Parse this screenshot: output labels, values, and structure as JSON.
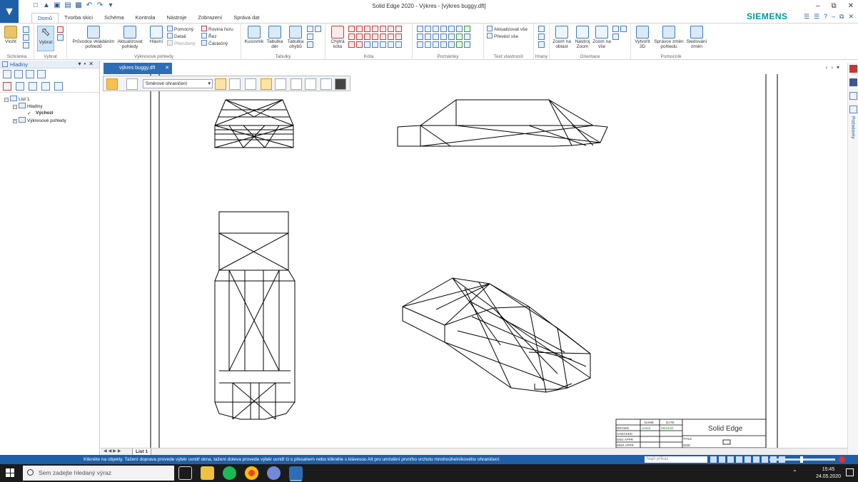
{
  "window": {
    "title": "Solid Edge 2020 - Výkres - [výkres buggy.dft]",
    "brand": "SIEMENS"
  },
  "ribbon_tabs": [
    {
      "label": "Domů",
      "active": true
    },
    {
      "label": "Tvorba skici",
      "active": false
    },
    {
      "label": "Schéma",
      "active": false
    },
    {
      "label": "Kontrola",
      "active": false
    },
    {
      "label": "Nástroje",
      "active": false
    },
    {
      "label": "Zobrazení",
      "active": false
    },
    {
      "label": "Správa dat",
      "active": false
    }
  ],
  "ribbon": {
    "clipboard": {
      "paste": "Vložit",
      "group": "Schránka"
    },
    "select": {
      "select": "Vybrat",
      "group": "Vybrat"
    },
    "views": {
      "wizard": "Průvodce vkládáním pohledů",
      "update": "Aktualizovat pohledy",
      "main": "Hlavní",
      "aux": "Pomocný",
      "detail": "Detail",
      "broken": "Přerušený",
      "cut_plane": "Rovina řezu",
      "section": "Řez",
      "partial": "Částečný",
      "group": "Výkresové pohledy"
    },
    "tables": {
      "bom": "Kusovník",
      "holes": "Tabulka děr",
      "bends": "Tabulka ohybů",
      "group": "Tabulky"
    },
    "dimension": {
      "smart": "Chytrá kóta",
      "group": "Kóta"
    },
    "notes": {
      "group": "Poznámky"
    },
    "properties": {
      "update_all": "Aktualizovat vše",
      "convert_all": "Převést vše",
      "group": "Text vlastností"
    },
    "edges": {
      "group": "Hrany"
    },
    "orient": {
      "zoom_area": "Zoom na oblast",
      "zoom_tool": "Nástroj Zoom",
      "fit": "Zoom na vše",
      "group": "Orientace"
    },
    "assist": {
      "create3d": "Vytvořit 3D",
      "view_changes": "Správce změn pohledu",
      "track": "Sledování změn",
      "group": "Pomocník"
    }
  },
  "left_panel": {
    "title": "Hladiny",
    "tree": [
      {
        "label": "List 1",
        "level": 0,
        "bold": false
      },
      {
        "label": "Hladiny",
        "level": 1,
        "bold": false
      },
      {
        "label": "Výchozí",
        "level": 2,
        "bold": true
      },
      {
        "label": "Výkresové pohledy",
        "level": 1,
        "bold": false
      }
    ]
  },
  "document_tab": "výkres buggy.dft",
  "command_bar": {
    "selection_mode": "Směrové ohraničení"
  },
  "right_strip": {
    "label": "Požadavky"
  },
  "sheet_tab": "List 1",
  "title_block": {
    "col_name": "NAME",
    "col_date": "DATE",
    "rows": [
      "DRAWN",
      "CHECKED",
      "ENG APPR",
      "MGR APPR"
    ],
    "drawn_name": "ocelal",
    "drawn_date": "05/24/20",
    "company": "Solid Edge",
    "title_label": "TITLE",
    "size": "SIZE"
  },
  "status": {
    "message": "Klikněte na objekty. Tažení doprava provede výběr uvnitř okna, tažení doleva provede výběr uvnitř či s přesahem nebo klikněte s klávesou Alt pro umístění prvního vrcholu mnohoúhelníkového ohraničení.",
    "search_placeholder": "Najít příkaz"
  },
  "taskbar": {
    "search_placeholder": "Sem zadejte hledaný výraz",
    "time": "15:45",
    "date": "24.05.2020"
  }
}
